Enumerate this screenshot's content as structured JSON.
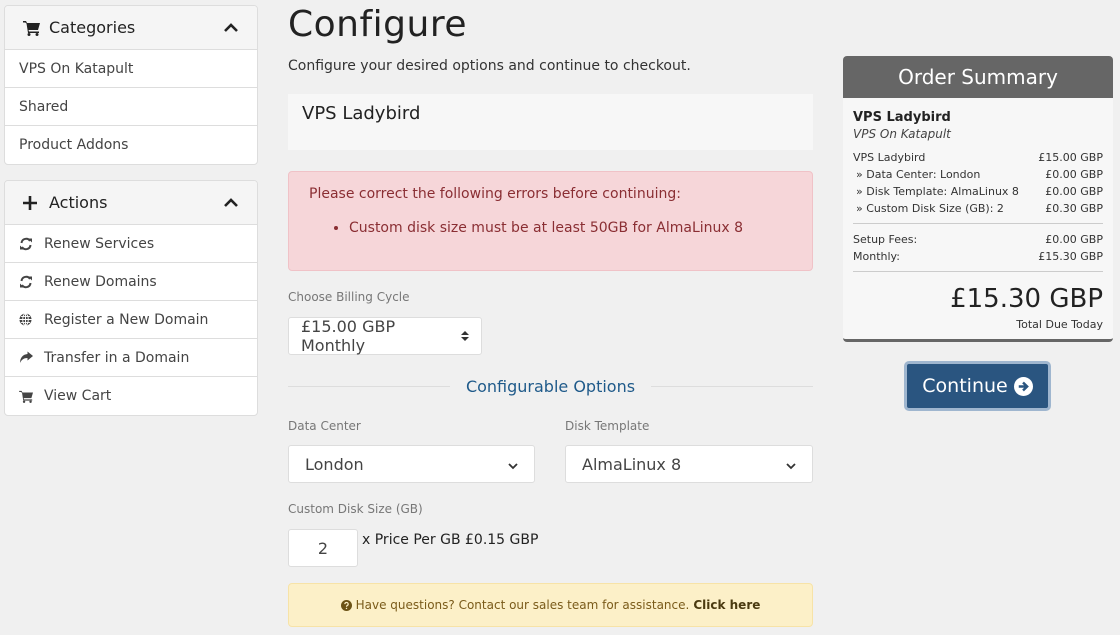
{
  "sidebar": {
    "categories": {
      "title": "Categories",
      "icon": "cart-icon",
      "items": [
        {
          "label": "VPS On Katapult"
        },
        {
          "label": "Shared"
        },
        {
          "label": "Product Addons"
        }
      ]
    },
    "actions": {
      "title": "Actions",
      "icon": "plus-icon",
      "items": [
        {
          "label": "Renew Services",
          "icon": "refresh-icon"
        },
        {
          "label": "Renew Domains",
          "icon": "refresh-icon"
        },
        {
          "label": "Register a New Domain",
          "icon": "globe-icon"
        },
        {
          "label": "Transfer in a Domain",
          "icon": "share-arrow-icon"
        },
        {
          "label": "View Cart",
          "icon": "cart-icon"
        }
      ]
    }
  },
  "main": {
    "title": "Configure",
    "subtitle": "Configure your desired options and continue to checkout.",
    "product_name": "VPS Ladybird",
    "error": {
      "heading": "Please correct the following errors before continuing:",
      "items": [
        "Custom disk size must be at least 50GB for AlmaLinux 8"
      ]
    },
    "billing": {
      "label": "Choose Billing Cycle",
      "selected": "£15.00 GBP Monthly"
    },
    "configurable_options_title": "Configurable Options",
    "data_center": {
      "label": "Data Center",
      "selected": "London"
    },
    "disk_template": {
      "label": "Disk Template",
      "selected": "AlmaLinux 8"
    },
    "custom_disk": {
      "label": "Custom Disk Size (GB)",
      "value": "2",
      "price_text": "x Price Per GB £0.15 GBP"
    },
    "help": {
      "text": "Have questions? Contact our sales team for assistance.",
      "link": "Click here"
    }
  },
  "summary": {
    "title": "Order Summary",
    "product": "VPS Ladybird",
    "group": "VPS On Katapult",
    "lines": [
      {
        "label": "VPS Ladybird",
        "amount": "£15.00 GBP"
      },
      {
        "label": "» Data Center: London",
        "amount": "£0.00 GBP"
      },
      {
        "label": "» Disk Template: AlmaLinux 8",
        "amount": "£0.00 GBP"
      },
      {
        "label": "» Custom Disk Size (GB): 2",
        "amount": "£0.30 GBP"
      }
    ],
    "setup_fees": {
      "label": "Setup Fees:",
      "amount": "£0.00 GBP"
    },
    "monthly": {
      "label": "Monthly:",
      "amount": "£15.30 GBP"
    },
    "total": "£15.30 GBP",
    "total_label": "Total Due Today"
  },
  "continue_label": "Continue",
  "colors": {
    "primary": "#2a5580",
    "summary_header": "#666666",
    "danger_bg": "#f6d6d9",
    "warning_bg": "#fcf0c8",
    "accent_text": "#1f5a8a"
  }
}
